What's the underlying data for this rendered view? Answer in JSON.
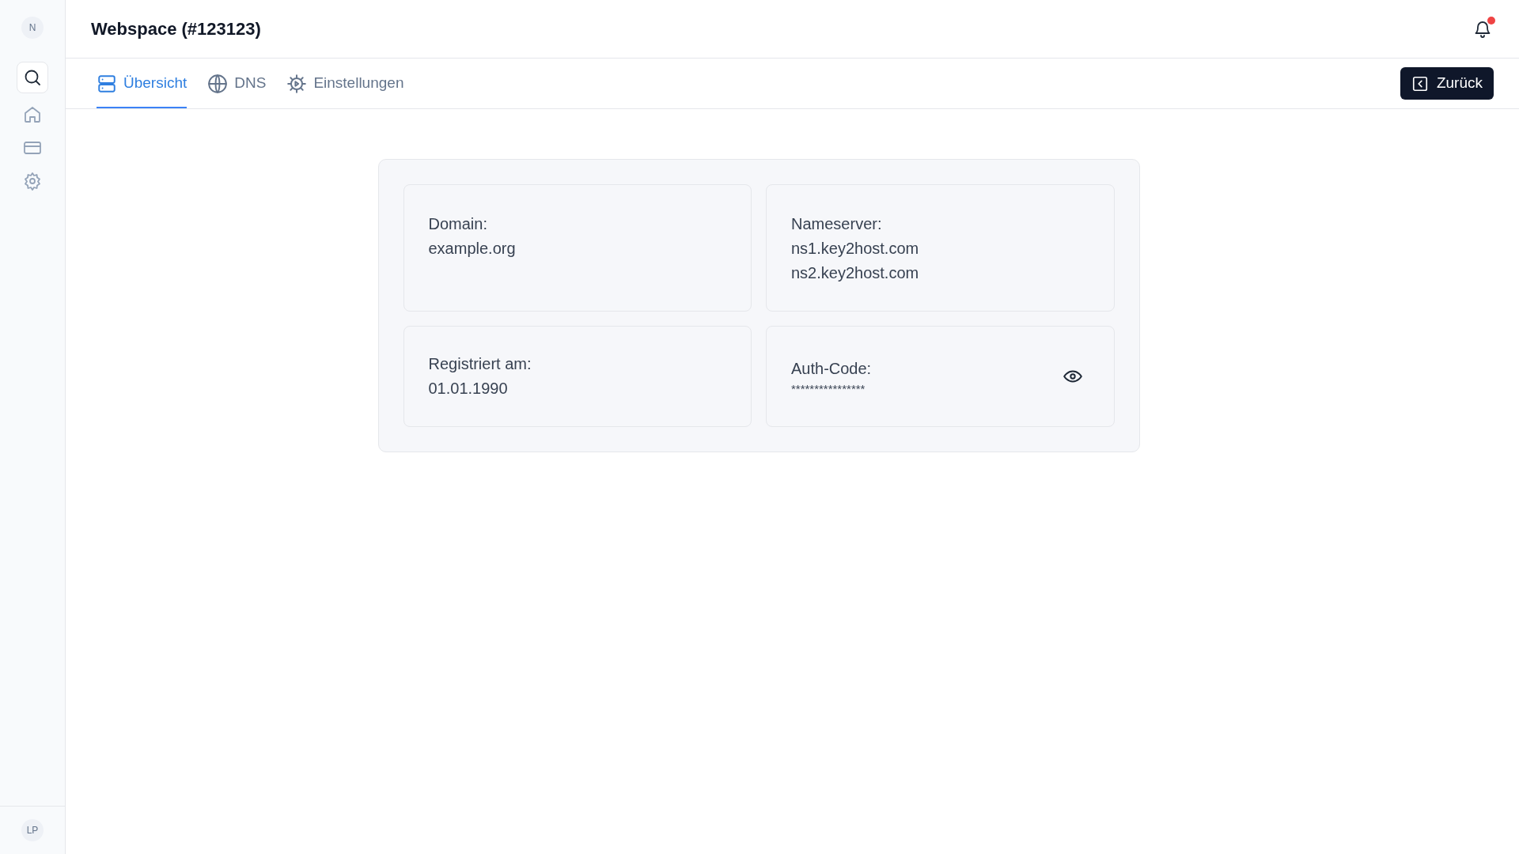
{
  "sidebar": {
    "top_avatar": "N",
    "items": [
      {
        "kind": "search",
        "selected": true
      },
      {
        "kind": "home",
        "selected": false
      },
      {
        "kind": "card",
        "selected": false
      },
      {
        "kind": "settings",
        "selected": false
      }
    ],
    "bottom_avatar": "LP"
  },
  "header": {
    "title": "Webspace (#123123)",
    "notifications_unread": true
  },
  "tabs": [
    {
      "label": "Übersicht",
      "kind": "server",
      "selected": true
    },
    {
      "label": "DNS",
      "kind": "globe",
      "selected": false
    },
    {
      "label": "Einstellungen",
      "kind": "gear",
      "selected": false
    }
  ],
  "back_button": "Zurück",
  "cards": [
    {
      "label": "Domain:",
      "lines": [
        "example.org"
      ],
      "secret": false
    },
    {
      "label": "Nameserver:",
      "lines": [
        "ns1.key2host.com",
        "ns2.key2host.com"
      ],
      "secret": false
    },
    {
      "label": "Registriert am:",
      "lines": [
        "01.01.1990"
      ],
      "secret": false
    },
    {
      "label": "Auth-Code:",
      "lines": [
        "****************"
      ],
      "secret": true
    }
  ]
}
